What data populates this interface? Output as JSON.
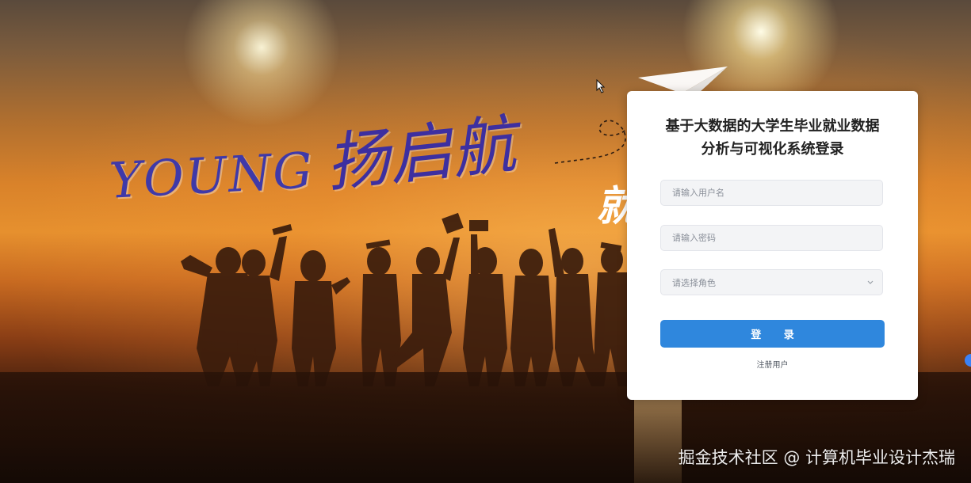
{
  "background": {
    "headline_en": "YOUNG",
    "headline_cn": "扬启航",
    "partial_char": "就"
  },
  "login": {
    "title_line1": "基于大数据的大学生毕业就业数据",
    "title_line2": "分析与可视化系统登录",
    "username_placeholder": "请输入用户名",
    "password_placeholder": "请输入密码",
    "role_placeholder": "请选择角色",
    "login_button": "登 录",
    "register_link": "注册用户"
  },
  "watermark": "掘金技术社区 @ 计算机毕业设计杰瑞",
  "colors": {
    "primary_button": "#2f87dd",
    "card_bg": "#ffffff",
    "input_bg": "#f3f4f6",
    "headline_purple": "#3f39a8"
  },
  "icons": {
    "select_chevron": "chevron-down-icon",
    "cursor": "mouse-pointer-icon",
    "paper_plane": "paper-plane-icon",
    "floating_button": "floating-action-icon"
  }
}
